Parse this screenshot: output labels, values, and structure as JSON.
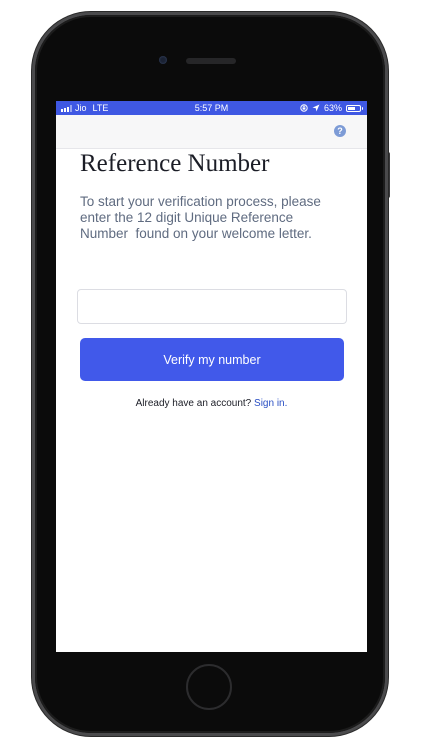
{
  "status_bar": {
    "carrier": "Jio",
    "network": "LTE",
    "time": "5:57 PM",
    "battery_percent": "63%",
    "battery_level": 0.63,
    "background_color": "#3f58e3",
    "icons": [
      "signal-bars-icon",
      "screen-lock-icon",
      "location-arrow-icon",
      "battery-icon"
    ]
  },
  "nav": {
    "help_label": "?",
    "help_color": "#7d9bd6"
  },
  "page": {
    "title": "Reference Number",
    "description": "To start your verification process, please enter the 12 digit Unique Reference Number  found on your welcome letter."
  },
  "form": {
    "reference_input_value": "",
    "reference_input_placeholder": "",
    "verify_button_label": "Verify my number",
    "button_color": "#4159ea"
  },
  "footer": {
    "account_prompt": "Already have an account?",
    "signin_link": "Sign in."
  }
}
